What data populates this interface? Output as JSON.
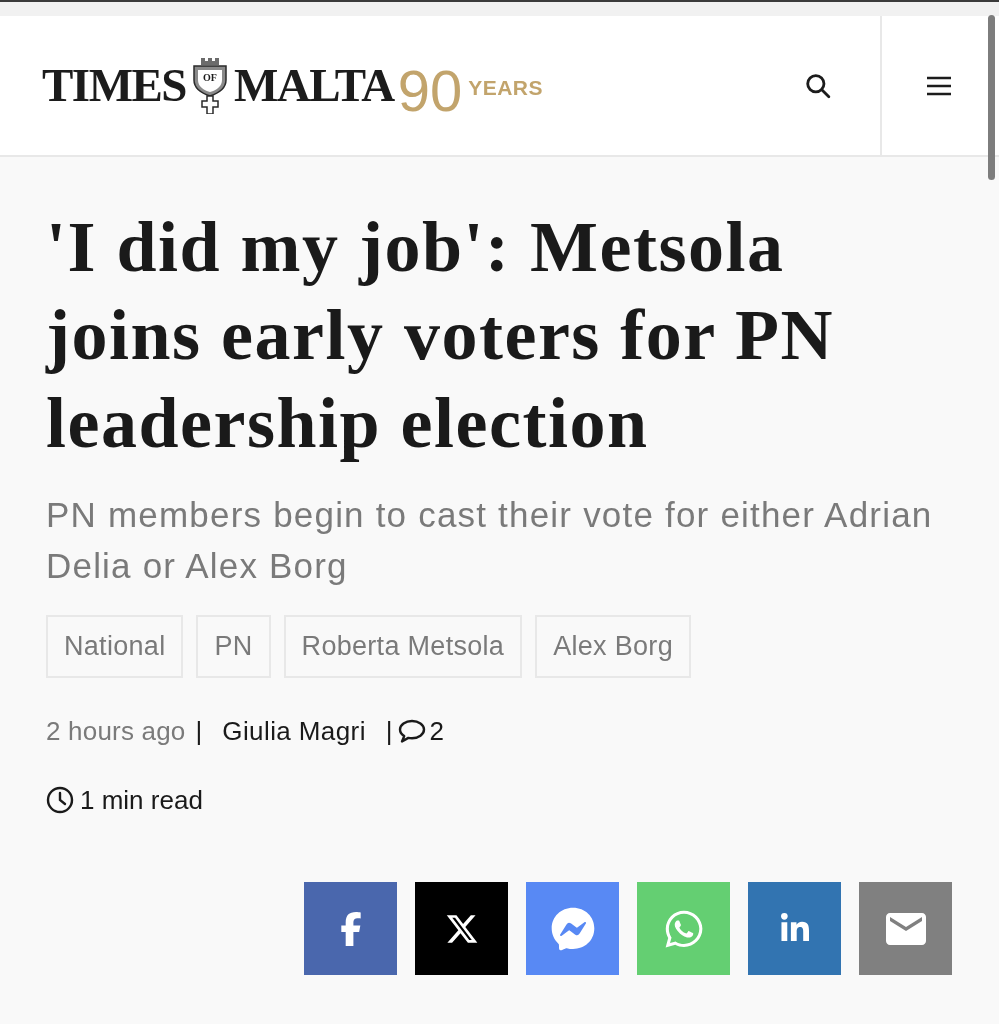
{
  "header": {
    "logo": {
      "word_1": "TIMES",
      "crest_text": "OF",
      "word_2": "MALTA",
      "anniversary_number": "90",
      "anniversary_label": "YEARS"
    }
  },
  "article": {
    "headline": "'I did my job': Metsola joins early voters for PN leadership election",
    "standfirst": "PN members begin to cast their vote for either Adrian Delia or Alex Borg",
    "tags": [
      "National",
      "PN",
      "Roberta Metsola",
      "Alex Borg"
    ],
    "meta": {
      "time": "2 hours ago",
      "separator_1": "|",
      "author": "Giulia Magri",
      "separator_2": "|",
      "comment_count": "2"
    },
    "read_time": "1 min read"
  },
  "share_buttons": [
    {
      "kind": "facebook",
      "color": "#4a67ad"
    },
    {
      "kind": "x",
      "color": "#000000"
    },
    {
      "kind": "messenger",
      "color": "#5889f4"
    },
    {
      "kind": "whatsapp",
      "color": "#64cf72"
    },
    {
      "kind": "linkedin",
      "color": "#3274b1"
    },
    {
      "kind": "email",
      "color": "#808080"
    }
  ]
}
